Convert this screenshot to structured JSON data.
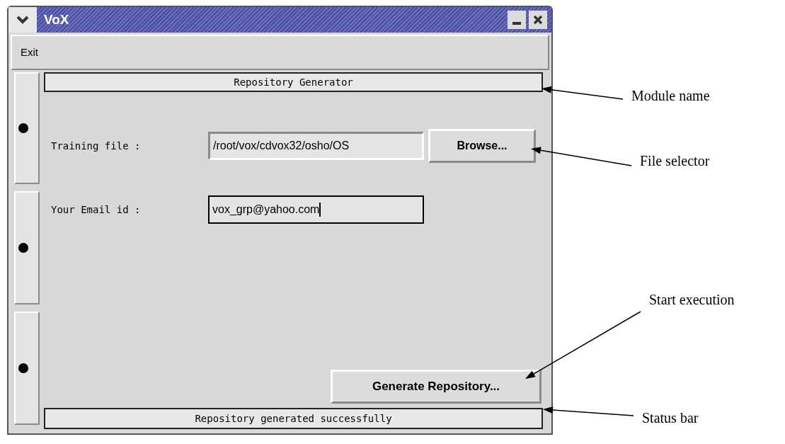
{
  "window": {
    "title": "VoX"
  },
  "menu": [
    {
      "label": "Exit"
    }
  ],
  "module_name": "Repository Generator",
  "fields": [
    {
      "label": "Training file :",
      "value": "/root/vox/cdvox32/osho/OS",
      "focused": false,
      "button": "Browse..."
    },
    {
      "label": "Your Email id :",
      "value": "vox_grp@yahoo.com",
      "focused": true
    }
  ],
  "generate_button": "Generate Repository...",
  "status_bar": "Repository generated successfully",
  "annotations": [
    {
      "text": "Module name"
    },
    {
      "text": "File selector"
    },
    {
      "text": "Start execution"
    },
    {
      "text": "Status bar"
    }
  ]
}
